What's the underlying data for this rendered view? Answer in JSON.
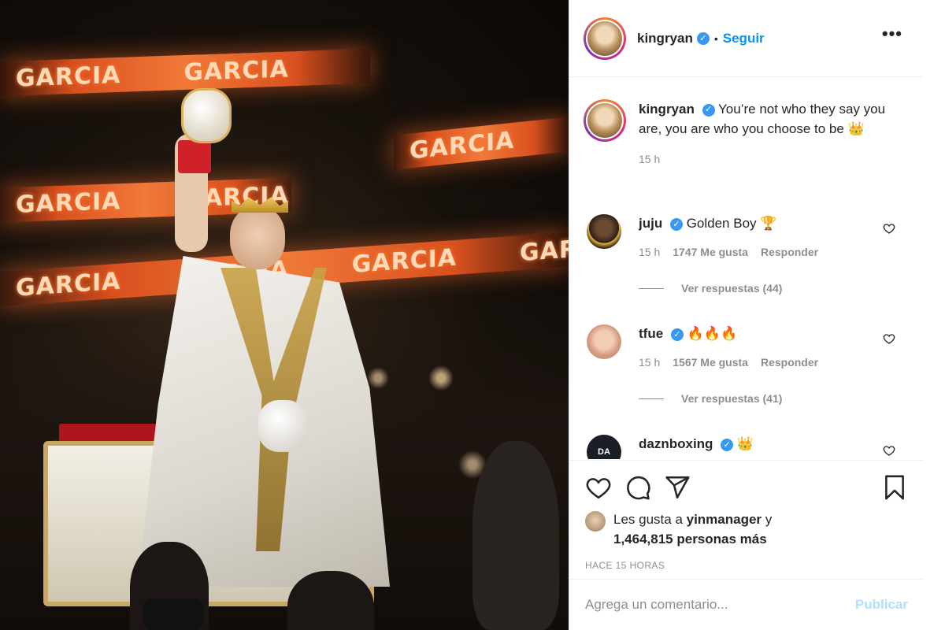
{
  "photo": {
    "banner_text": "GARCIA",
    "alt_subject": "boxer-on-throne"
  },
  "header": {
    "username": "kingryan",
    "separator": "•",
    "follow_label": "Seguir",
    "more_label": "•••"
  },
  "caption": {
    "username": "kingryan",
    "text": "You’re not who they say you are, you are who you choose to be 👑",
    "time": "15 h"
  },
  "comments": [
    {
      "username": "juju",
      "text": "Golden Boy 🏆",
      "time": "15 h",
      "likes": "1747 Me gusta",
      "reply_label": "Responder",
      "view_replies": "Ver respuestas (44)"
    },
    {
      "username": "tfue",
      "text": "🔥🔥🔥",
      "time": "15 h",
      "likes": "1567 Me gusta",
      "reply_label": "Responder",
      "view_replies": "Ver respuestas (41)"
    },
    {
      "username": "daznboxing",
      "text": "👑"
    }
  ],
  "actions": {
    "likes_prefix": "Les gusta a ",
    "likes_user": "yinmanager",
    "likes_mid": " y",
    "likes_count": "1,464,815 personas más",
    "timestamp": "HACE 15 HORAS"
  },
  "add_comment": {
    "placeholder": "Agrega un comentario...",
    "publish_label": "Publicar"
  },
  "colors": {
    "link_blue": "#0095f6",
    "verified_blue": "#3897f0",
    "publish_disabled": "#b2dffc",
    "muted_text": "#8e8e8e"
  }
}
